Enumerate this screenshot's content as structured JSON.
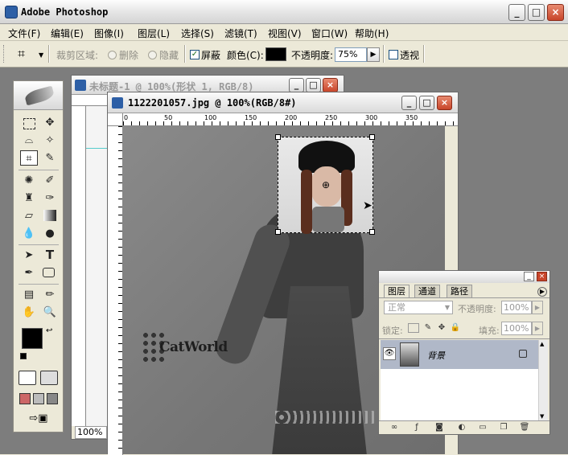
{
  "app": {
    "title": "Adobe Photoshop",
    "icon": "photoshop-icon"
  },
  "window_controls": {
    "minimize": "_",
    "maximize": "□",
    "close": "×"
  },
  "menu": [
    "文件(F)",
    "编辑(E)",
    "图像(I)",
    "图层(L)",
    "选择(S)",
    "滤镜(T)",
    "视图(V)",
    "窗口(W)",
    "帮助(H)"
  ],
  "options": {
    "crop_area_label": "裁剪区域:",
    "delete_label": "删除",
    "hide_label": "隐藏",
    "shield_label": "屏蔽",
    "shield_checked": true,
    "color_label": "颜色(C):",
    "shield_color": "#000000",
    "opacity_label": "不透明度:",
    "opacity_value": "75%",
    "perspective_label": "透视",
    "perspective_checked": false
  },
  "doc_back": {
    "title": "未标题-1 @ 100%(形状 1, RGB/8)"
  },
  "doc_front": {
    "title": "1122201057.jpg @ 100%(RGB/8#)",
    "ruler_labels": [
      "0",
      "50",
      "100",
      "150",
      "200",
      "250",
      "300",
      "350"
    ]
  },
  "toolbox": {
    "zoom_value": "100%"
  },
  "canvas": {
    "watermark": "CatWorld"
  },
  "layers_panel": {
    "tabs": [
      "图层",
      "通道",
      "路径"
    ],
    "blend_mode": "正常",
    "opacity_label": "不透明度:",
    "opacity_value": "100%",
    "lock_label": "锁定:",
    "fill_label": "填充:",
    "fill_value": "100%",
    "layer_name": "背景"
  },
  "colors": {
    "accent_title": "#2d5fa6",
    "workspace": "#7d7d7d",
    "foreground": "#000000",
    "background": "#ffffff"
  }
}
